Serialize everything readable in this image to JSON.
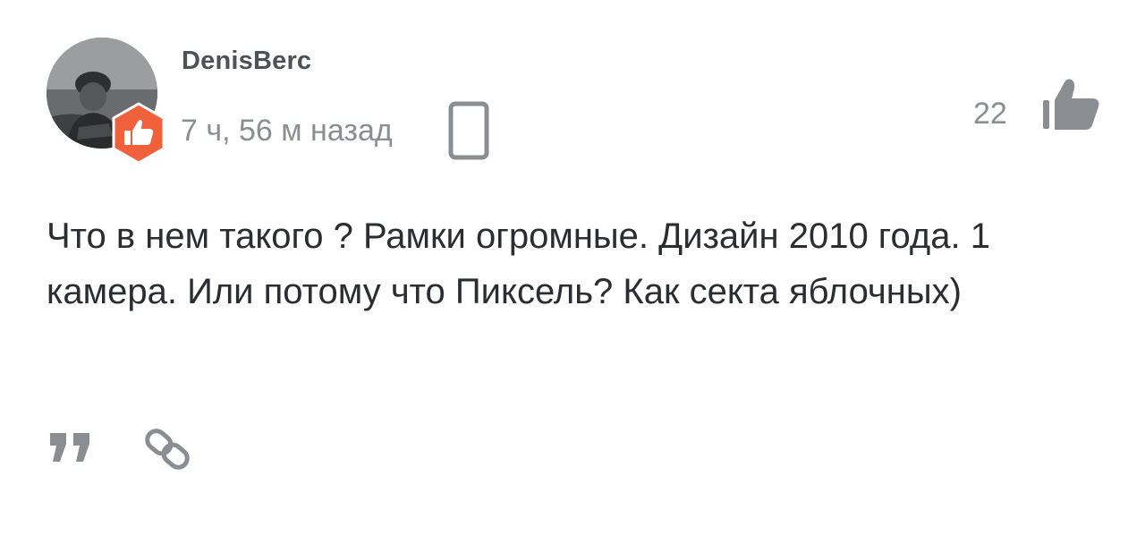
{
  "comment": {
    "author": "DenisBerc",
    "time_ago": "7 ч, 56 м назад",
    "rating": "22",
    "text": "Что в нем такого ? Рамки огромные. Дизайн 2010 года. 1 камера. Или потому что Пиксель? Как секта яблочных)"
  },
  "icons": {
    "avatar": "user-avatar-photo",
    "badge": "thumbs-up-rank-badge",
    "device": "smartphone-icon",
    "like": "thumbs-up-icon",
    "quote": "quote-icon",
    "link": "link-icon"
  },
  "colors": {
    "badge": "#f0603a",
    "muted": "#8a8d92",
    "text": "#2b2d30",
    "author": "#4e5156"
  }
}
